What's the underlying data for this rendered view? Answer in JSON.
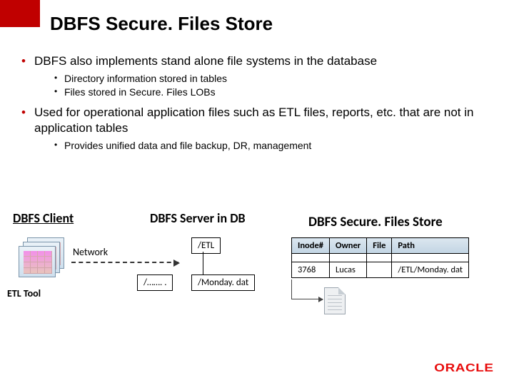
{
  "title": "DBFS Secure. Files Store",
  "bullets": {
    "b1": "DBFS also implements stand alone file systems in the database",
    "b1a": "Directory information stored in tables",
    "b1b": "Files stored in Secure. Files LOBs",
    "b2": "Used for operational application files such as ETL files, reports, etc. that are not in application tables",
    "b2a": "Provides unified data and file backup, DR, management"
  },
  "diagram": {
    "client_heading": "DBFS Client",
    "server_heading": "DBFS Server in DB",
    "store_heading": "DBFS Secure. Files Store",
    "etl_label": "ETL Tool",
    "network_label": "Network",
    "folder_etl": "/ETL",
    "folder_dots": "/……. .",
    "file_monday": "/Monday. dat"
  },
  "table": {
    "headers": {
      "inode": "Inode#",
      "owner": "Owner",
      "file": "File",
      "path": "Path"
    },
    "row": {
      "inode": "3768",
      "owner": "Lucas",
      "file": "",
      "path": "/ETL/Monday. dat"
    }
  },
  "logo": "ORACLE"
}
